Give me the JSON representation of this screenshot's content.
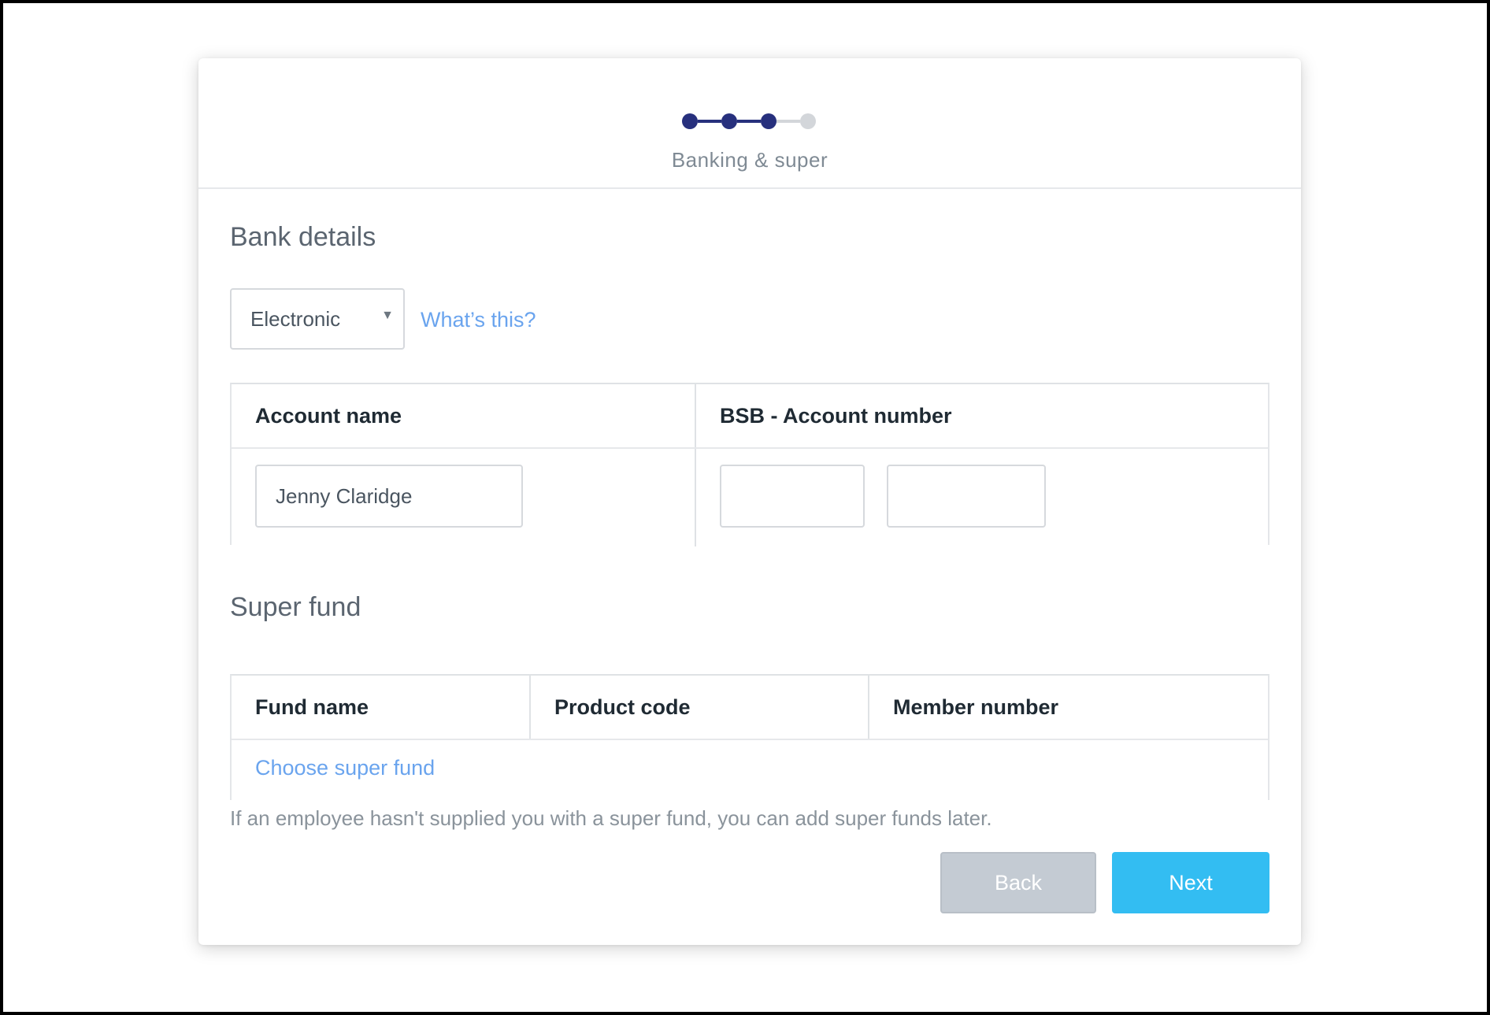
{
  "stepper": {
    "current_step_label": "Banking & super",
    "total_steps": 4,
    "completed_steps": 3
  },
  "bank": {
    "section_title": "Bank details",
    "payment_method": "Electronic",
    "whats_this_link": "What’s this?",
    "columns": [
      "Account name",
      "BSB - Account number"
    ],
    "account_name_value": "Jenny Claridge",
    "bsb_value": "",
    "account_number_value": ""
  },
  "super": {
    "section_title": "Super fund",
    "columns": [
      "Fund name",
      "Product code",
      "Member number"
    ],
    "choose_link": "Choose super fund",
    "hint": "If an employee hasn't supplied you with a super fund, you can add super funds later."
  },
  "actions": {
    "back_label": "Back",
    "next_label": "Next"
  },
  "colors": {
    "step_active": "#27307d",
    "step_inactive": "#d3d6da",
    "link": "#6aa4ee",
    "next_button": "#33bdf2",
    "back_button": "#c4cbd3"
  }
}
